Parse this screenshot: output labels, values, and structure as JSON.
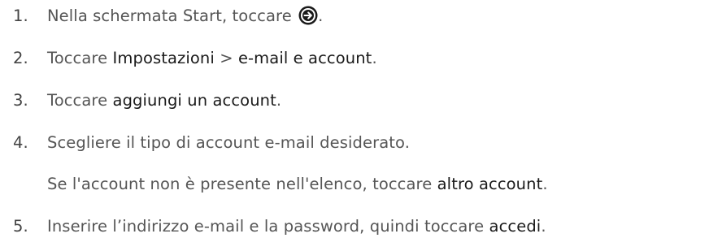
{
  "steps": [
    {
      "number": "1.",
      "text_before": "Nella schermata Start, toccare ",
      "icon": "circle-arrow-right-icon",
      "text_after": "."
    },
    {
      "number": "2.",
      "text_before": "Toccare ",
      "highlight_1": "Impostazioni",
      "separator": " > ",
      "highlight_2": "e-mail e account",
      "text_after": "."
    },
    {
      "number": "3.",
      "text_before": "Toccare ",
      "highlight": "aggiungi un account",
      "text_after": "."
    },
    {
      "number": "4.",
      "text": "Scegliere il tipo di account e-mail desiderato.",
      "note_before": "Se l'account non è presente nell'elenco, toccare ",
      "note_highlight": "altro account",
      "note_after": "."
    },
    {
      "number": "5.",
      "text_before": "Inserire l’indirizzo e-mail e la password, quindi toccare ",
      "highlight": "accedi",
      "text_after": "."
    }
  ],
  "colors": {
    "body_text": "#555555",
    "highlight_text": "#1a1a1a",
    "icon_fill": "#1a1a1a"
  }
}
